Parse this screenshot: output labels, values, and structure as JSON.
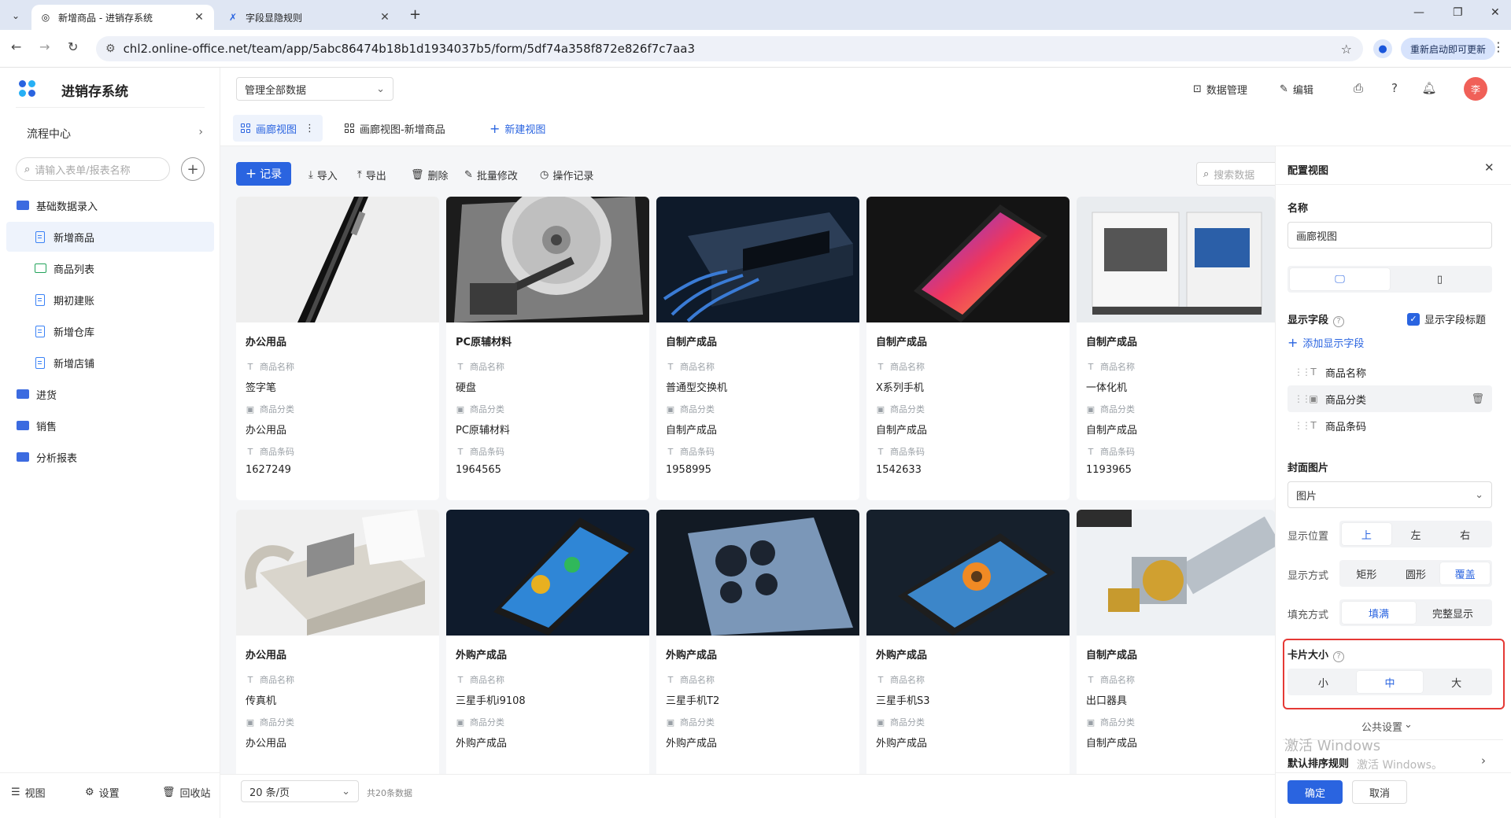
{
  "browser": {
    "tabs": [
      {
        "title": "新增商品 - 进销存系统",
        "active": true
      },
      {
        "title": "字段显隐规则",
        "active": false
      }
    ],
    "url": "chl2.online-office.net/team/app/5abc86474b18b1d1934037b5/form/5df74a358f872e826f7c7aa3",
    "update_button": "重新启动即可更新"
  },
  "app": {
    "title": "进销存系统",
    "flow_center": "流程中心",
    "search_placeholder": "请输入表单/报表名称",
    "tree": [
      {
        "label": "基础数据录入",
        "type": "group"
      },
      {
        "label": "新增商品",
        "type": "doc",
        "selected": true
      },
      {
        "label": "商品列表",
        "type": "list"
      },
      {
        "label": "期初建账",
        "type": "doc"
      },
      {
        "label": "新增仓库",
        "type": "doc"
      },
      {
        "label": "新增店铺",
        "type": "doc"
      },
      {
        "label": "进货",
        "type": "group"
      },
      {
        "label": "销售",
        "type": "group"
      },
      {
        "label": "分析报表",
        "type": "group"
      }
    ],
    "footer": {
      "view": "视图",
      "settings": "设置",
      "recycle": "回收站"
    }
  },
  "header": {
    "data_scope": "管理全部数据",
    "data_manage": "数据管理",
    "edit": "编辑",
    "avatar": "李"
  },
  "view_tabs": [
    {
      "label": "画廊视图",
      "active": true
    },
    {
      "label": "画廊视图-新增商品",
      "active": false
    }
  ],
  "new_view": "新建视图",
  "toolbar": {
    "record": "记录",
    "import": "导入",
    "export": "导出",
    "delete": "删除",
    "batch_edit": "批量修改",
    "op_log": "操作记录",
    "search_placeholder": "搜索数据"
  },
  "field_labels": {
    "name": "商品名称",
    "category": "商品分类",
    "code": "商品条码"
  },
  "cards": [
    {
      "category": "办公用品",
      "name": "签字笔",
      "cat_value": "办公用品",
      "code": "1627249",
      "img": "pen"
    },
    {
      "category": "PC原辅材料",
      "name": "硬盘",
      "cat_value": "PC原辅材料",
      "code": "1964565",
      "img": "hdd"
    },
    {
      "category": "自制产成品",
      "name": "普通型交换机",
      "cat_value": "自制产成品",
      "code": "1958995",
      "img": "switch"
    },
    {
      "category": "自制产成品",
      "name": "X系列手机",
      "cat_value": "自制产成品",
      "code": "1542633",
      "img": "phonex"
    },
    {
      "category": "自制产成品",
      "name": "一体化机",
      "cat_value": "自制产成品",
      "code": "1193965",
      "img": "machine"
    },
    {
      "category": "办公用品",
      "name": "传真机",
      "cat_value": "办公用品",
      "code": "",
      "img": "fax"
    },
    {
      "category": "外购产成品",
      "name": "三星手机i9108",
      "cat_value": "外购产成品",
      "code": "",
      "img": "galaxy"
    },
    {
      "category": "外购产成品",
      "name": "三星手机T2",
      "cat_value": "外购产成品",
      "code": "",
      "img": "samsung"
    },
    {
      "category": "外购产成品",
      "name": "三星手机S3",
      "cat_value": "外购产成品",
      "code": "",
      "img": "s3"
    },
    {
      "category": "自制产成品",
      "name": "出口器具",
      "cat_value": "自制产成品",
      "code": "",
      "img": "valve"
    }
  ],
  "pagination": {
    "page_size": "20 条/页",
    "total": "共20条数据"
  },
  "panel": {
    "title": "配置视图",
    "name_label": "名称",
    "name_value": "画廊视图",
    "display_fields": "显示字段",
    "show_field_title": "显示字段标题",
    "add_field": "添加显示字段",
    "fields": [
      "商品名称",
      "商品分类",
      "商品条码"
    ],
    "cover_label": "封面图片",
    "cover_value": "图片",
    "position_label": "显示位置",
    "position_opts": [
      "上",
      "左",
      "右"
    ],
    "mode_label": "显示方式",
    "mode_opts": [
      "矩形",
      "圆形",
      "覆盖"
    ],
    "fill_label": "填充方式",
    "fill_opts": [
      "填满",
      "完整显示"
    ],
    "card_size_label": "卡片大小",
    "card_size_opts": [
      "小",
      "中",
      "大"
    ],
    "common_settings": "公共设置",
    "default_sort": "默认排序规则",
    "confirm": "确定",
    "cancel": "取消"
  },
  "watermark": {
    "line1": "激活 Windows",
    "line2": "激活 Windows。"
  },
  "colors": {
    "primary": "#2a64e0",
    "highlight_border": "#e53935",
    "avatar": "#f06058"
  }
}
